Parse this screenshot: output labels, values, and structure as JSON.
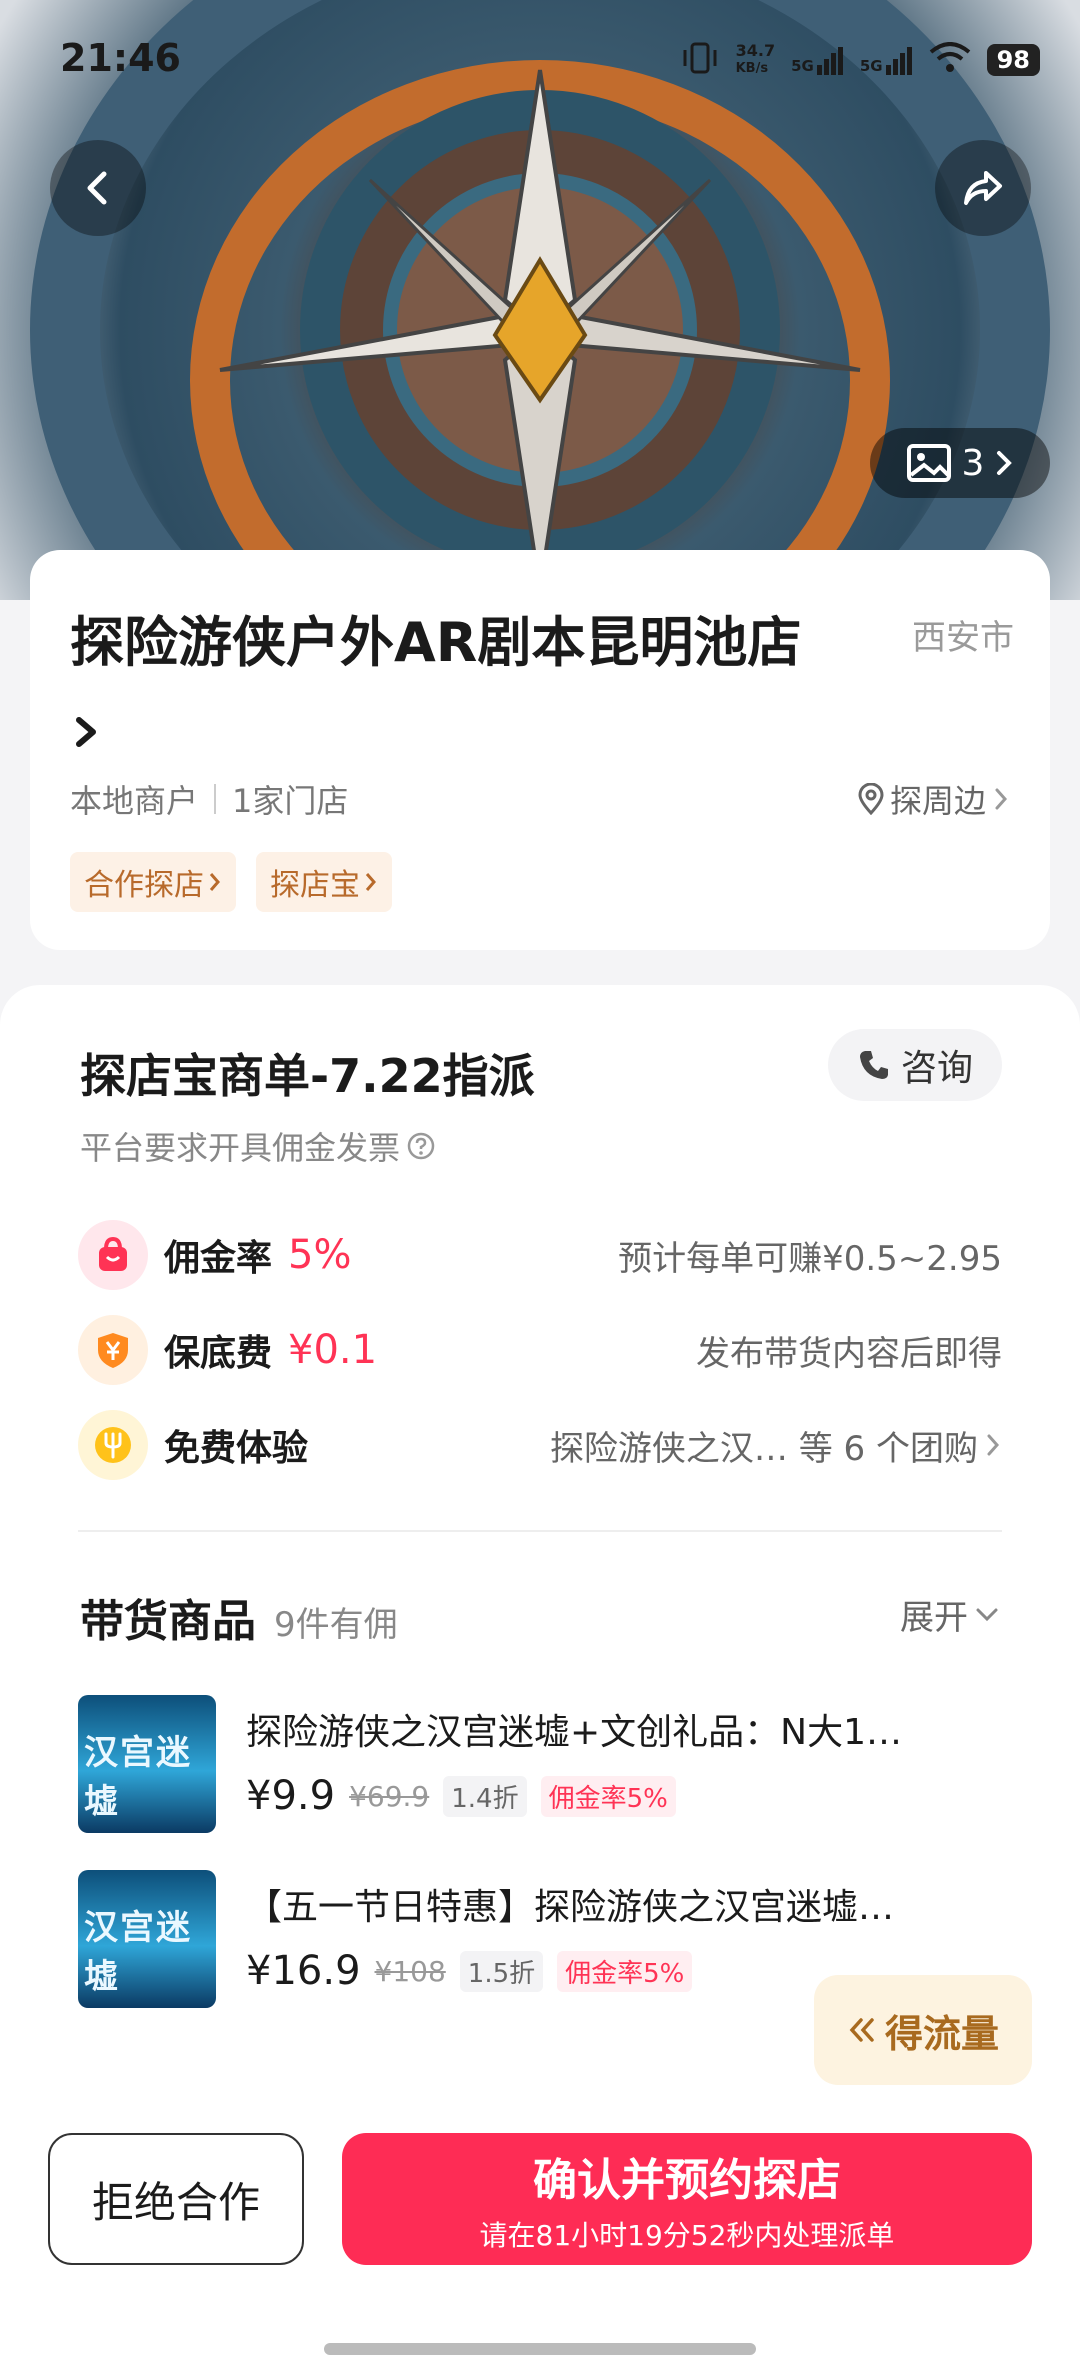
{
  "status_bar": {
    "time": "21:46",
    "net_speed_value": "34.7",
    "net_speed_unit": "KB/s",
    "sim1": "5G",
    "sim2": "5G",
    "battery": "98"
  },
  "hero": {
    "gallery_count": "3",
    "icons": [
      "back-icon",
      "share-icon",
      "image-icon",
      "chevron-right-icon"
    ]
  },
  "store": {
    "name": "探险游侠户外AR剧本昆明池店",
    "city": "西安市",
    "merchant_type": "本地商户",
    "store_count": "1家门店",
    "nearby_label": "探周边",
    "tags": [
      "合作探店",
      "探店宝"
    ]
  },
  "order": {
    "title": "探店宝商单-7.22指派",
    "consult_label": "咨询",
    "invoice_note": "平台要求开具佣金发票",
    "rows": [
      {
        "label": "佣金率",
        "value": "5%",
        "desc": "预计每单可赚¥0.5~2.95"
      },
      {
        "label": "保底费",
        "value": "¥0.1",
        "desc": "发布带货内容后即得"
      },
      {
        "label": "免费体验",
        "value": "",
        "desc": "探险游侠之汉… 等 6 个团购"
      }
    ]
  },
  "goods": {
    "title": "带货商品",
    "count": "9件有佣",
    "expand_label": "展开",
    "items": [
      {
        "thumb_text": "汉宫迷墟",
        "name": "探险游侠之汉宫迷墟+文创礼品：N大1…",
        "price": "¥9.9",
        "orig_price": "¥69.9",
        "discount": "1.4折",
        "commission": "佣金率5%"
      },
      {
        "thumb_text": "汉宫迷墟",
        "name": "【五一节日特惠】探险游侠之汉宫迷墟…",
        "price": "¥16.9",
        "orig_price": "¥108",
        "discount": "1.5折",
        "commission": "佣金率5%"
      }
    ]
  },
  "traffic_bubble": "得流量",
  "bottom": {
    "reject_label": "拒绝合作",
    "confirm_label": "确认并预约探店",
    "confirm_sub": "请在81小时19分52秒内处理派单"
  },
  "colors": {
    "accent": "#fe2c55",
    "tag_bg": "#fdf1e6",
    "tag_text": "#b86a2b"
  }
}
